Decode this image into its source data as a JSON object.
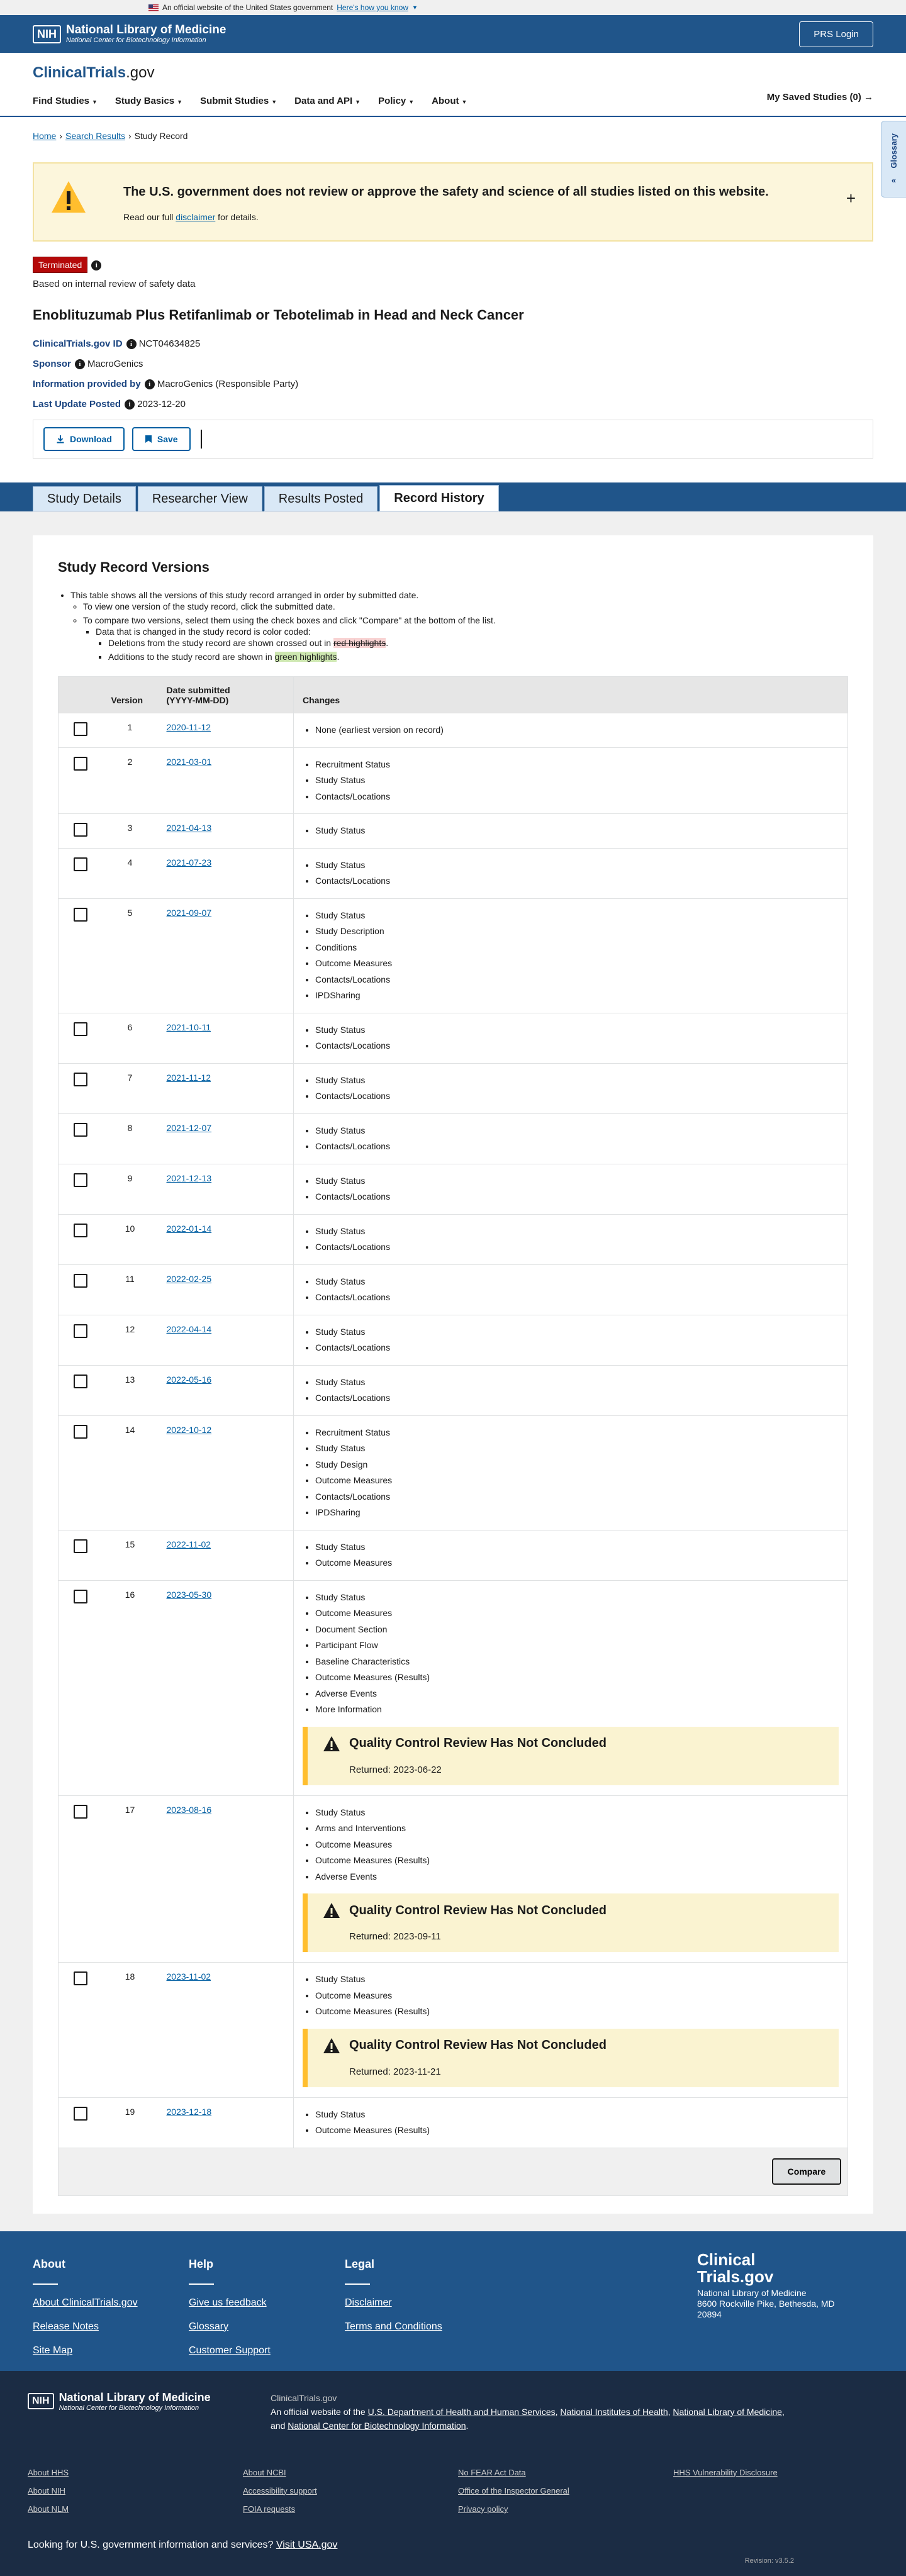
{
  "gov_banner": {
    "text": "An official website of the United States government",
    "link": "Here's how you know"
  },
  "nih": {
    "box": "NIH",
    "title": "National Library of Medicine",
    "subtitle": "National Center for Biotechnology Information",
    "prs_login": "PRS Login"
  },
  "ct": {
    "logo_main": "ClinicalTrials",
    "logo_suffix": ".gov",
    "nav": [
      "Find Studies",
      "Study Basics",
      "Submit Studies",
      "Data and API",
      "Policy",
      "About"
    ],
    "saved": "My Saved Studies (0)"
  },
  "glossary": "Glossary",
  "breadcrumb": {
    "home": "Home",
    "search": "Search Results",
    "current": "Study Record"
  },
  "alert": {
    "headline": "The U.S. government does not review or approve the safety and science of all studies listed on this website.",
    "pre": "Read our full ",
    "link": "disclaimer",
    "post": " for details."
  },
  "study": {
    "status": "Terminated",
    "status_reason": "Based on internal review of safety data",
    "title": "Enoblituzumab Plus Retifanlimab or Tebotelimab in Head and Neck Cancer",
    "id_label": "ClinicalTrials.gov ID",
    "id_value": "NCT04634825",
    "sponsor_label": "Sponsor",
    "sponsor_value": "MacroGenics",
    "info_label": "Information provided by",
    "info_value": "MacroGenics (Responsible Party)",
    "update_label": "Last Update Posted",
    "update_value": "2023-12-20"
  },
  "actions": {
    "download": "Download",
    "save": "Save"
  },
  "tabs": [
    "Study Details",
    "Researcher View",
    "Results Posted",
    "Record History"
  ],
  "history": {
    "heading": "Study Record Versions",
    "note1": "This table shows all the versions of this study record arranged in order by submitted date.",
    "note2": "To view one version of the study record, click the submitted date.",
    "note3": "To compare two versions, select them using the check boxes and click \"Compare\" at the bottom of the list.",
    "note4": "Data that is changed in the study record is color coded:",
    "note5_pre": "Deletions from the study record are shown crossed out in ",
    "note5_hl": "red highlights",
    "note6_pre": "Additions to the study record are shown in ",
    "note6_hl": "green highlights",
    "col_version": "Version",
    "col_date_1": "Date submitted",
    "col_date_2": "(YYYY-MM-DD)",
    "col_changes": "Changes",
    "compare": "Compare",
    "qc_title": "Quality Control Review Has Not Concluded",
    "rows": [
      {
        "v": "1",
        "date": "2020-11-12",
        "changes": [
          "None (earliest version on record)"
        ]
      },
      {
        "v": "2",
        "date": "2021-03-01",
        "changes": [
          "Recruitment Status",
          "Study Status",
          "Contacts/Locations"
        ]
      },
      {
        "v": "3",
        "date": "2021-04-13",
        "changes": [
          "Study Status"
        ]
      },
      {
        "v": "4",
        "date": "2021-07-23",
        "changes": [
          "Study Status",
          "Contacts/Locations"
        ]
      },
      {
        "v": "5",
        "date": "2021-09-07",
        "changes": [
          "Study Status",
          "Study Description",
          "Conditions",
          "Outcome Measures",
          "Contacts/Locations",
          "IPDSharing"
        ]
      },
      {
        "v": "6",
        "date": "2021-10-11",
        "changes": [
          "Study Status",
          "Contacts/Locations"
        ]
      },
      {
        "v": "7",
        "date": "2021-11-12",
        "changes": [
          "Study Status",
          "Contacts/Locations"
        ]
      },
      {
        "v": "8",
        "date": "2021-12-07",
        "changes": [
          "Study Status",
          "Contacts/Locations"
        ]
      },
      {
        "v": "9",
        "date": "2021-12-13",
        "changes": [
          "Study Status",
          "Contacts/Locations"
        ]
      },
      {
        "v": "10",
        "date": "2022-01-14",
        "changes": [
          "Study Status",
          "Contacts/Locations"
        ]
      },
      {
        "v": "11",
        "date": "2022-02-25",
        "changes": [
          "Study Status",
          "Contacts/Locations"
        ]
      },
      {
        "v": "12",
        "date": "2022-04-14",
        "changes": [
          "Study Status",
          "Contacts/Locations"
        ]
      },
      {
        "v": "13",
        "date": "2022-05-16",
        "changes": [
          "Study Status",
          "Contacts/Locations"
        ]
      },
      {
        "v": "14",
        "date": "2022-10-12",
        "changes": [
          "Recruitment Status",
          "Study Status",
          "Study Design",
          "Outcome Measures",
          "Contacts/Locations",
          "IPDSharing"
        ]
      },
      {
        "v": "15",
        "date": "2022-11-02",
        "changes": [
          "Study Status",
          "Outcome Measures"
        ]
      },
      {
        "v": "16",
        "date": "2023-05-30",
        "changes": [
          "Study Status",
          "Outcome Measures",
          "Document Section",
          "Participant Flow",
          "Baseline Characteristics",
          "Outcome Measures (Results)",
          "Adverse Events",
          "More Information"
        ],
        "qc_returned": "Returned: 2023-06-22"
      },
      {
        "v": "17",
        "date": "2023-08-16",
        "changes": [
          "Study Status",
          "Arms and Interventions",
          "Outcome Measures",
          "Outcome Measures (Results)",
          "Adverse Events"
        ],
        "qc_returned": "Returned: 2023-09-11"
      },
      {
        "v": "18",
        "date": "2023-11-02",
        "changes": [
          "Study Status",
          "Outcome Measures",
          "Outcome Measures (Results)"
        ],
        "qc_returned": "Returned: 2023-11-21"
      },
      {
        "v": "19",
        "date": "2023-12-18",
        "changes": [
          "Study Status",
          "Outcome Measures (Results)"
        ]
      }
    ]
  },
  "footer": {
    "about_h": "About",
    "about_links": [
      "About ClinicalTrials.gov",
      "Release Notes",
      "Site Map"
    ],
    "help_h": "Help",
    "help_links": [
      "Give us feedback",
      "Glossary",
      "Customer Support"
    ],
    "legal_h": "Legal",
    "legal_links": [
      "Disclaimer",
      "Terms and Conditions"
    ],
    "brand_1": "Clinical",
    "brand_2": "Trials.gov",
    "address_1": "National Library of Medicine",
    "address_2": "8600 Rockville Pike, Bethesda, MD",
    "address_3": "20894",
    "site": "ClinicalTrials.gov",
    "official_pre": "An official website of the ",
    "hhs": "U.S. Department of Health and Human Services",
    "nih_link": "National Institutes of Health",
    "nlm_link": "National Library of Medicine",
    "and": "and ",
    "ncbi_link": "National Center for Biotechnology Information",
    "bottom_links": [
      "About HHS",
      "About NCBI",
      "No FEAR Act Data",
      "HHS Vulnerability Disclosure",
      "About NIH",
      "Accessibility support",
      "Office of the Inspector General",
      "",
      "About NLM",
      "FOIA requests",
      "Privacy policy",
      ""
    ],
    "usa_text": "Looking for U.S. government information and services?",
    "usa_link": "Visit USA.gov",
    "revision": "Revision: v3.5.2"
  }
}
